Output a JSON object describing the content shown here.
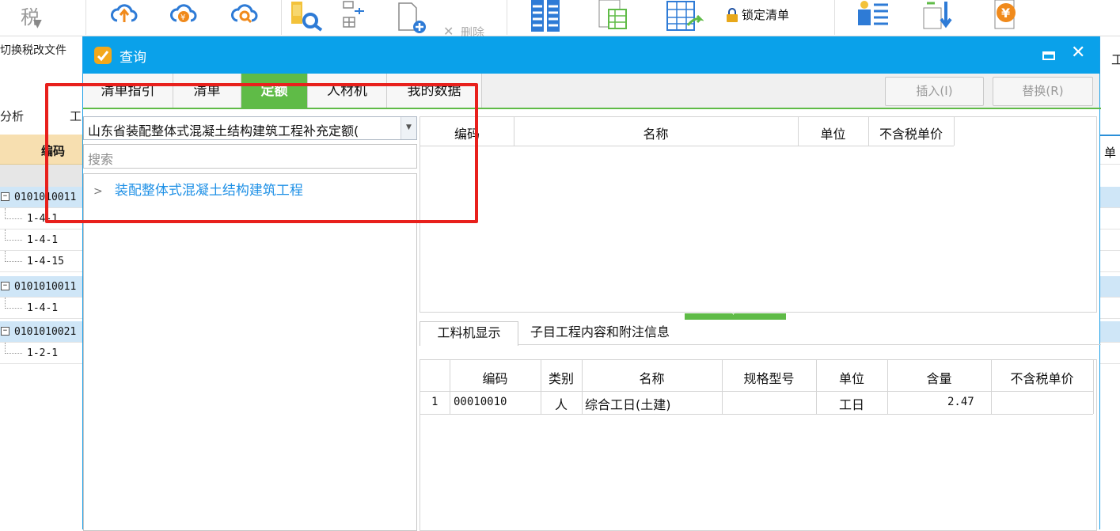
{
  "toolbar": {
    "tax_switch_char": "税",
    "tax_switch_label": "切换税改文件",
    "delete_label": "删除",
    "lock_label": "锁定清单"
  },
  "background": {
    "analysis_tab": "分析",
    "work_tab": "工",
    "code_header": "编码",
    "right_tab": "工",
    "right_header": "单",
    "rows": [
      {
        "text": "0101010011",
        "kind": "parent"
      },
      {
        "text": "1-4-1",
        "kind": "child"
      },
      {
        "text": "1-4-1",
        "kind": "child"
      },
      {
        "text": "1-4-15",
        "kind": "child"
      },
      {
        "text": "0101010011",
        "kind": "parent"
      },
      {
        "text": "1-4-1",
        "kind": "child"
      },
      {
        "text": "0101010021",
        "kind": "parent"
      },
      {
        "text": "1-2-1",
        "kind": "child"
      }
    ]
  },
  "dialog": {
    "title": "查询",
    "tabs": [
      {
        "label": "清单指引",
        "active": false
      },
      {
        "label": "清单",
        "active": false
      },
      {
        "label": "定额",
        "active": true
      },
      {
        "label": "人材机",
        "active": false
      },
      {
        "label": "我的数据",
        "active": false
      }
    ],
    "insert_button": "插入(I)",
    "replace_button": "替换(R)",
    "library_select": "山东省装配整体式混凝土结构建筑工程补充定额(",
    "search_placeholder": "搜索",
    "tree_item": "装配整体式混凝土结构建筑工程",
    "top_table": {
      "headers": [
        "编码",
        "名称",
        "单位",
        "不含税单价"
      ]
    },
    "bottom_tabs": [
      "工料机显示",
      "子目工程内容和附注信息"
    ],
    "bottom_table": {
      "headers": [
        "编码",
        "类别",
        "名称",
        "规格型号",
        "单位",
        "含量",
        "不含税单价"
      ],
      "rows": [
        {
          "index": "1",
          "code": "00010010",
          "category": "人",
          "name": "综合工日(土建)",
          "spec": "",
          "unit": "工日",
          "quantity": "2.47",
          "price": ""
        }
      ]
    }
  },
  "colors": {
    "titlebar": "#0aa1ea",
    "active_tab": "#5fbb47",
    "highlight": "#e8201c",
    "link": "#1e90e6"
  }
}
